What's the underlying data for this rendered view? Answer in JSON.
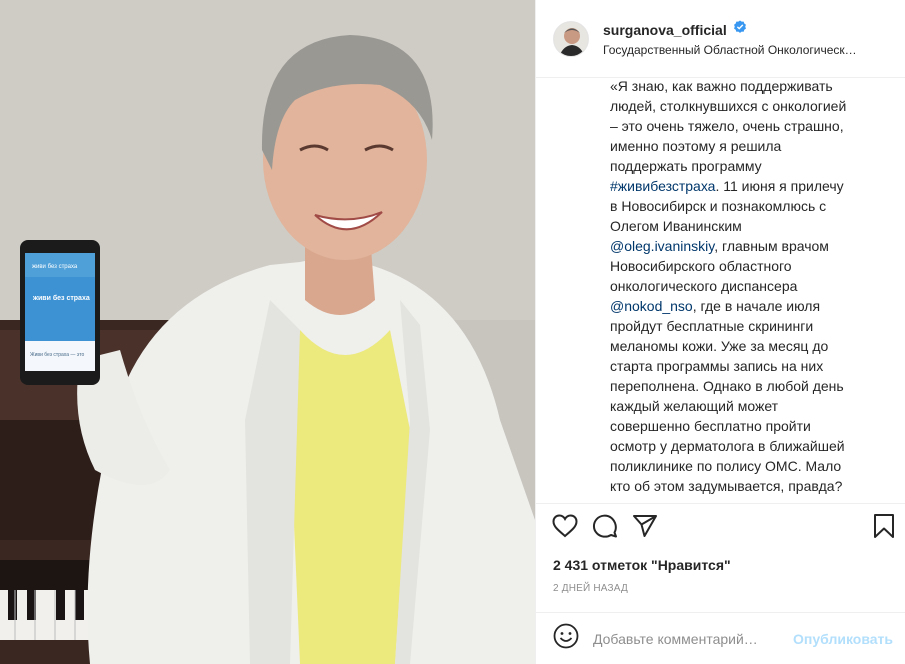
{
  "post": {
    "username": "surganova_official",
    "location": "Государственный Областной Онкологическ…",
    "caption_lines": [
      {
        "text": "«Я знаю, как важно поддерживать"
      },
      {
        "text": "людей, столкнувшихся с онкологией"
      },
      {
        "text": "– это очень тяжело, очень страшно,"
      },
      {
        "text": "именно поэтому я решила"
      },
      {
        "text": "поддержать программу"
      },
      {
        "link": "#живибезстраха",
        "text": ". 11 июня я прилечу"
      },
      {
        "text": "в Новосибирск и познакомлюсь с"
      },
      {
        "text": "Олегом Иванинским"
      },
      {
        "link": "@oleg.ivaninskiy",
        "text": ", главным врачом"
      },
      {
        "text": "Новосибирского областного"
      },
      {
        "text": "онкологического диспансера"
      },
      {
        "link": "@nokod_nso",
        "text": ", где в начале июля"
      },
      {
        "text": "пройдут бесплатные скрининги"
      },
      {
        "text": "меланомы кожи. Уже за месяц до"
      },
      {
        "text": "старта программы запись на них"
      },
      {
        "text": "переполнена. Однако в любой день"
      },
      {
        "text": "каждый желающий может"
      },
      {
        "text": "совершенно бесплатно пройти"
      },
      {
        "text": "осмотр у дерматолога в ближайшей"
      },
      {
        "text": "поликлинике по полису ОМС. Мало"
      },
      {
        "text": "кто об этом задумывается, правда?"
      }
    ],
    "likes": "2 431 отметок \"Нравится\"",
    "time": "2 дней назад",
    "comment_placeholder": "Добавьте комментарий…",
    "post_button": "Опубликовать"
  },
  "phone": {
    "header": "живи без страха",
    "title": "живи без страха",
    "footer": "Живи без страха — это"
  },
  "icons": {
    "like": "heart-icon",
    "comment": "comment-icon",
    "share": "paper-plane-icon",
    "save": "bookmark-icon",
    "emoji": "emoji-icon",
    "verified": "verified-badge-icon"
  },
  "colors": {
    "link": "#00376b",
    "verified": "#3897f0",
    "post_button": "#b2dffc",
    "secondary": "#8e8e8e"
  }
}
